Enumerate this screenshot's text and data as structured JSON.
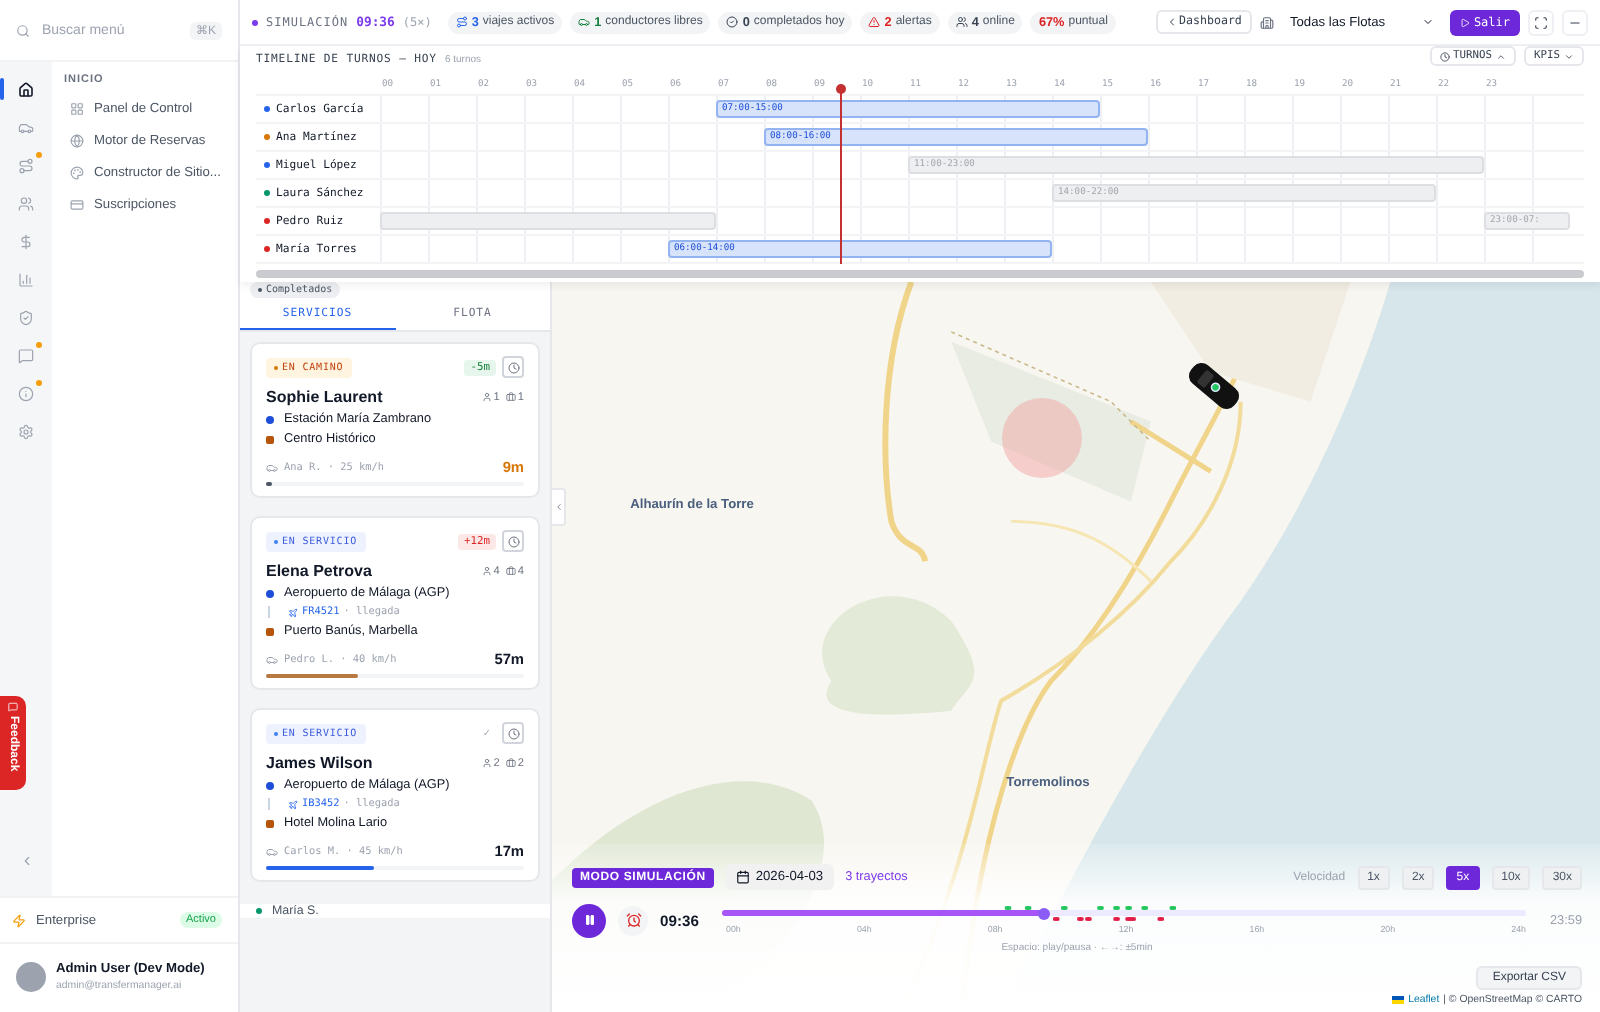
{
  "sidebar": {
    "search": {
      "placeholder": "Buscar menú",
      "shortcut": "⌘K"
    },
    "rail": [
      {
        "kind": "home",
        "selected": true,
        "alert": false
      },
      {
        "kind": "car",
        "selected": false,
        "alert": false
      },
      {
        "kind": "route",
        "selected": false,
        "alert": true
      },
      {
        "kind": "users",
        "selected": false,
        "alert": false
      },
      {
        "kind": "dollar",
        "selected": false,
        "alert": false
      },
      {
        "kind": "chart",
        "selected": false,
        "alert": false
      },
      {
        "kind": "shield",
        "selected": false,
        "alert": false
      },
      {
        "kind": "message",
        "selected": false,
        "alert": true
      },
      {
        "kind": "info",
        "selected": false,
        "alert": true
      },
      {
        "kind": "settings",
        "selected": false,
        "alert": false
      }
    ],
    "section": "INICIO",
    "menu": [
      {
        "kind": "grid",
        "label": "Panel de Control"
      },
      {
        "kind": "globe",
        "label": "Motor de Reservas"
      },
      {
        "kind": "palette",
        "label": "Constructor de Sitio..."
      },
      {
        "kind": "card",
        "label": "Suscripciones"
      }
    ],
    "feedback": "Feedback",
    "plan": {
      "name": "Enterprise",
      "status": "Activo"
    },
    "user": {
      "name": "Admin User (Dev Mode)",
      "email": "admin@transfermanager.ai"
    }
  },
  "topbar": {
    "mode": "SIMULACIÓN",
    "clock": "09:36",
    "speed": "(5×)",
    "stats": [
      {
        "kind": "trips",
        "value": "3",
        "label": "viajes activos"
      },
      {
        "kind": "drivers",
        "value": "1",
        "label": "conductores libres"
      },
      {
        "kind": "completed",
        "value": "0",
        "label": "completados hoy"
      },
      {
        "kind": "alerts",
        "value": "2",
        "label": "alertas"
      },
      {
        "kind": "online",
        "value": "4",
        "label": "online"
      },
      {
        "kind": "punctual",
        "value": "67%",
        "label": "puntual"
      }
    ],
    "back": "Dashboard",
    "fleet": "Todas las Flotas",
    "exit": "Salir"
  },
  "timeline": {
    "title": "TIMELINE DE TURNOS — HOY",
    "count": "6 turnos",
    "toggles": [
      {
        "label": "TURNOS",
        "expanded": true
      },
      {
        "label": "KPIS",
        "expanded": false
      }
    ],
    "hours": [
      "00",
      "01",
      "02",
      "03",
      "04",
      "05",
      "06",
      "07",
      "08",
      "09",
      "10",
      "11",
      "12",
      "13",
      "14",
      "15",
      "16",
      "17",
      "18",
      "19",
      "20",
      "21",
      "22",
      "23"
    ],
    "rows": [
      {
        "name": "Carlos García",
        "color": "#2563eb",
        "shifts": [
          {
            "kind": "shift",
            "label": "07:00-15:00",
            "active": true
          }
        ]
      },
      {
        "name": "Ana Martínez",
        "color": "#d97706",
        "shifts": [
          {
            "kind": "shift",
            "label": "08:00-16:00",
            "active": true
          }
        ]
      },
      {
        "name": "Miguel López",
        "color": "#2563eb",
        "shifts": [
          {
            "kind": "shift",
            "label": "11:00-23:00",
            "active": false
          }
        ]
      },
      {
        "name": "Laura Sánchez",
        "color": "#059669",
        "shifts": [
          {
            "kind": "shift",
            "label": "14:00-22:00",
            "active": false
          }
        ]
      },
      {
        "name": "Pedro Ruiz",
        "color": "#dc2626",
        "shifts": [
          {
            "kind": "carryover",
            "active": false
          },
          {
            "kind": "shift",
            "label": "23:00-07:",
            "active": false
          }
        ]
      },
      {
        "name": "María Torres",
        "color": "#dc2626",
        "shifts": [
          {
            "kind": "shift",
            "label": "06:00-14:00",
            "active": true
          }
        ]
      }
    ]
  },
  "left": {
    "filter": "Completados",
    "tabs": [
      {
        "label": "SERVICIOS",
        "selected": true
      },
      {
        "label": "FLOTA",
        "selected": false
      }
    ],
    "services": [
      {
        "status": {
          "kind": "en_route",
          "label": "EN CAMINO"
        },
        "delay": {
          "kind": "early",
          "text": "-5m"
        },
        "name": "Sophie Laurent",
        "passengers": "1",
        "bags": "1",
        "origin": "Estación María Zambrano",
        "destination": "Centro Histórico",
        "driver": "Ana R. · 25 km/h",
        "eta": {
          "kind": "warning",
          "text": "9m"
        },
        "level": 0.02,
        "color": "#4b5563"
      },
      {
        "status": {
          "kind": "in_service",
          "label": "EN SERVICIO"
        },
        "delay": {
          "kind": "late",
          "text": "+12m"
        },
        "name": "Elena Petrova",
        "passengers": "4",
        "bags": "4",
        "origin": "Aeropuerto de Málaga (AGP)",
        "flight": {
          "code": "FR4521",
          "note": "· llegada"
        },
        "destination": "Puerto Banús, Marbella",
        "driver": "Pedro L. · 40 km/h",
        "eta": {
          "kind": "normal",
          "text": "57m"
        },
        "level": 0.36,
        "color": "#b7793f"
      },
      {
        "status": {
          "kind": "in_service",
          "label": "EN SERVICIO"
        },
        "delay": {
          "kind": "ontime",
          "text": "✓"
        },
        "name": "James Wilson",
        "passengers": "2",
        "bags": "2",
        "origin": "Aeropuerto de Málaga (AGP)",
        "flight": {
          "code": "IB3452",
          "note": "· llegada"
        },
        "destination": "Hotel Molina Lario",
        "driver": "Carlos M. · 45 km/h",
        "eta": {
          "kind": "normal",
          "text": "17m"
        },
        "level": 0.42,
        "color": "#2563eb"
      }
    ],
    "drivers": [
      {
        "name": "María S.",
        "color": "#059669"
      }
    ]
  },
  "map": {
    "places": [
      {
        "name": "Alhaurín de la Torre"
      },
      {
        "name": "Torremolinos"
      }
    ]
  },
  "simulation": {
    "badge": "MODO SIMULACIÓN",
    "date": "2026-04-03",
    "trips": "3 trayectos",
    "speed_label": "Velocidad",
    "speeds": [
      {
        "label": "1x",
        "selected": false
      },
      {
        "label": "2x",
        "selected": false
      },
      {
        "label": "5x",
        "selected": true
      },
      {
        "label": "10x",
        "selected": false
      },
      {
        "label": "30x",
        "selected": false
      }
    ],
    "playing": true,
    "clock": "09:36",
    "level": 0.4,
    "ticks": [
      "00h",
      "04h",
      "08h",
      "12h",
      "16h",
      "20h",
      "24h"
    ],
    "end": "23:59",
    "hint": "Espacio: play/pausa · ←→: ±5min",
    "export": "Exportar CSV",
    "attribution": {
      "link": "Leaflet",
      "text": "| © OpenStreetMap © CARTO"
    }
  }
}
